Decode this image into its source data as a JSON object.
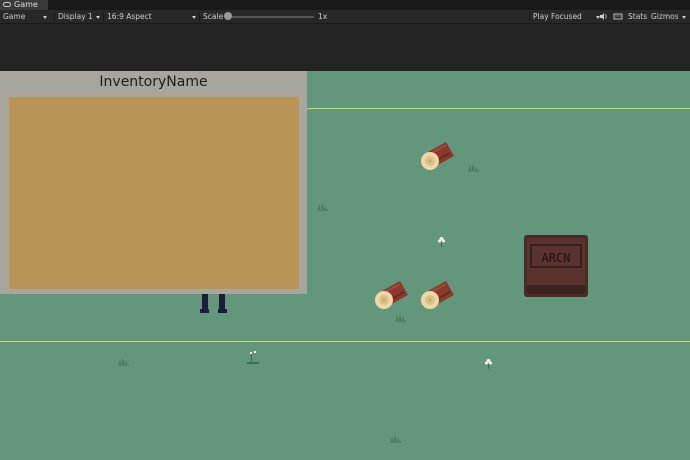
{
  "tab": {
    "label": "Game"
  },
  "toolbar": {
    "display_mode": "Game",
    "display": "Display 1",
    "aspect": "16:9 Aspect",
    "scale_label": "Scale",
    "scale_value": "1x",
    "play_mode": "Play Focused",
    "stats": "Stats",
    "gizmos": "Gizmos"
  },
  "inventory": {
    "title": "InventoryName"
  },
  "chest": {
    "label": "ARCN"
  },
  "colors": {
    "grass": "#63977c",
    "inventory_frame": "#a8a69c",
    "inventory_slot_area": "#b89456",
    "chest": "#4a2a26",
    "log_bark": "#8a3a2c",
    "log_end": "#f0d8a6"
  },
  "scene": {
    "logs": [
      "log",
      "log",
      "log"
    ],
    "flowers": [
      "flower",
      "flower",
      "flower"
    ],
    "grass_tufts": [
      "tuft",
      "tuft",
      "tuft",
      "tuft",
      "tuft"
    ]
  }
}
